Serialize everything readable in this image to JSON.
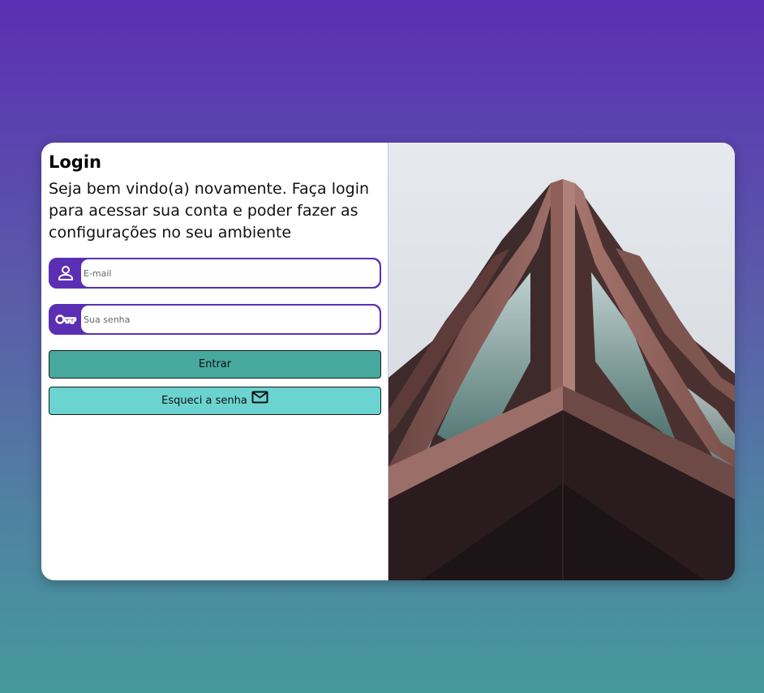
{
  "login": {
    "title": "Login",
    "subtitle": "Seja bem vindo(a) novamente. Faça login para acessar sua conta e poder fazer as configurações no seu ambiente",
    "email": {
      "placeholder": "E-mail",
      "value": "",
      "icon": "person-icon"
    },
    "password": {
      "placeholder": "Sua senha",
      "value": "",
      "icon": "key-icon"
    },
    "submit_label": "Entrar",
    "forgot_label": "Esqueci a senha",
    "forgot_icon": "mail-icon"
  },
  "colors": {
    "primary_purple": "#5b2fb3",
    "button_teal": "#47a89d",
    "button_light_teal": "#6bd4d0",
    "background_top": "#5b2fb3",
    "background_bottom": "#45999b"
  },
  "hero_image": {
    "subject": "building-facade-photo"
  }
}
